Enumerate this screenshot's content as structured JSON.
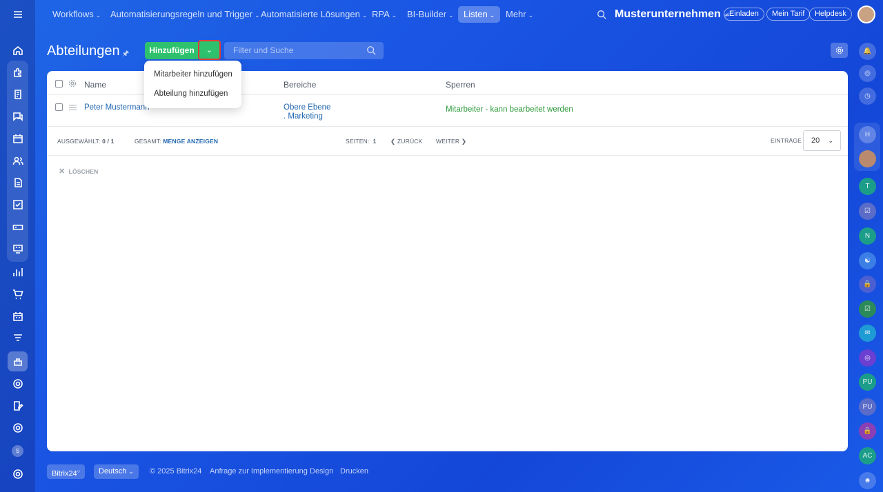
{
  "topnav": {
    "items": [
      {
        "label": "Workflows"
      },
      {
        "label": "Automatisierungsregeln und Trigger"
      },
      {
        "label": "Automatisierte Lösungen"
      },
      {
        "label": "RPA"
      },
      {
        "label": "BI-Builder"
      },
      {
        "label": "Listen"
      },
      {
        "label": "Mehr"
      }
    ],
    "company": "Musterunternehmen",
    "invite": "Einladen",
    "plan": "Mein Tarif",
    "helpdesk": "Helpdesk"
  },
  "page": {
    "title": "Abteilungen",
    "add_button": "Hinzufügen",
    "search_placeholder": "Filter und Suche"
  },
  "dropdown": {
    "items": [
      "Mitarbeiter hinzufügen",
      "Abteilung hinzufügen"
    ]
  },
  "table": {
    "columns": [
      "Name",
      "Bereiche",
      "Sperren"
    ],
    "rows": [
      {
        "name": "Peter Mustermann",
        "area_line1": "Obere Ebene",
        "area_line2": ". Marketing",
        "lock": "Mitarbeiter - kann bearbeitet werden"
      }
    ]
  },
  "pager": {
    "selected_label": "AUSGEWÄHLT:",
    "selected_value": "0 / 1",
    "total_label": "GESAMT:",
    "total_link": "MENGE ANZEIGEN",
    "pages_label": "SEITEN:",
    "page": "1",
    "back": "ZURÜCK",
    "next": "WEITER",
    "entries_label": "EINTRÄGE",
    "entries_value": "20"
  },
  "actions": {
    "delete": "LÖSCHEN"
  },
  "footer": {
    "brand": "Bitrix24",
    "language": "Deutsch",
    "copyright": "© 2025 Bitrix24",
    "link1": "Anfrage zur Implementierung",
    "link2": "Design",
    "link3": "Drucken"
  },
  "right_bar": {
    "initials": [
      "H",
      "T",
      "N",
      "PU",
      "PU",
      "AC"
    ]
  },
  "left_bar": {
    "letter": "S"
  },
  "colors": {
    "accent": "#2fc26e",
    "link": "#2067b0",
    "highlight": "#e03b3b"
  }
}
